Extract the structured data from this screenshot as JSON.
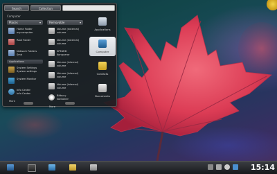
{
  "menu": {
    "search_button": "Search",
    "collection_button": "Collection",
    "search_placeholder": "",
    "breadcrumb": "Computer",
    "left_column": {
      "header": "Places",
      "items": [
        {
          "label": "Home Folder\nmy.computer",
          "icon": "home-folder-icon"
        },
        {
          "label": "Root Folder",
          "icon": "root-folder-icon"
        },
        {
          "label": "Network Folders\nSmb",
          "icon": "network-folder-icon"
        }
      ],
      "subheader": "Applications",
      "apps": [
        {
          "label": "System Settings\nSystem settings",
          "icon": "system-settings-icon"
        },
        {
          "label": "System Monitor",
          "icon": "system-monitor-icon"
        },
        {
          "label": "Info Center\nInfo Center",
          "icon": "info-center-icon"
        }
      ],
      "more_label": "More"
    },
    "right_column": {
      "header": "Removable",
      "items": [
        {
          "label": "Volume (external)\nvolume",
          "icon": "drive-icon"
        },
        {
          "label": "Volume (external)\nvolume",
          "icon": "drive-icon"
        },
        {
          "label": "SPEARD\nKonqueror",
          "icon": "drive-icon"
        },
        {
          "label": "Volume (internal)\nvolume",
          "icon": "drive-icon"
        },
        {
          "label": "Volume (internal)\nvolume",
          "icon": "drive-icon"
        },
        {
          "label": "Volume (internal)\nvolume",
          "icon": "drive-icon"
        },
        {
          "label": "Bitbucy\nkontainer",
          "icon": "cd-icon"
        }
      ],
      "more_label": "More"
    },
    "categories": [
      {
        "label": "Applications",
        "icon": "applications-icon",
        "active": false
      },
      {
        "label": "Computer",
        "icon": "computer-icon",
        "active": true
      },
      {
        "label": "Contacts",
        "icon": "contacts-icon",
        "active": false
      },
      {
        "label": "Documents",
        "icon": "documents-icon",
        "active": false
      }
    ]
  },
  "taskbar": {
    "clock": "15:14",
    "launchers": [
      "home-icon",
      "console-icon",
      "desktop-icon",
      "folder-icon",
      "drive-icon"
    ],
    "tray": [
      "device-notifier-icon",
      "network-icon",
      "volume-icon",
      "display-icon"
    ]
  },
  "colors": {
    "leaf": "#e0405a",
    "panel": "#1c1e22",
    "clock": "#ffffff"
  }
}
